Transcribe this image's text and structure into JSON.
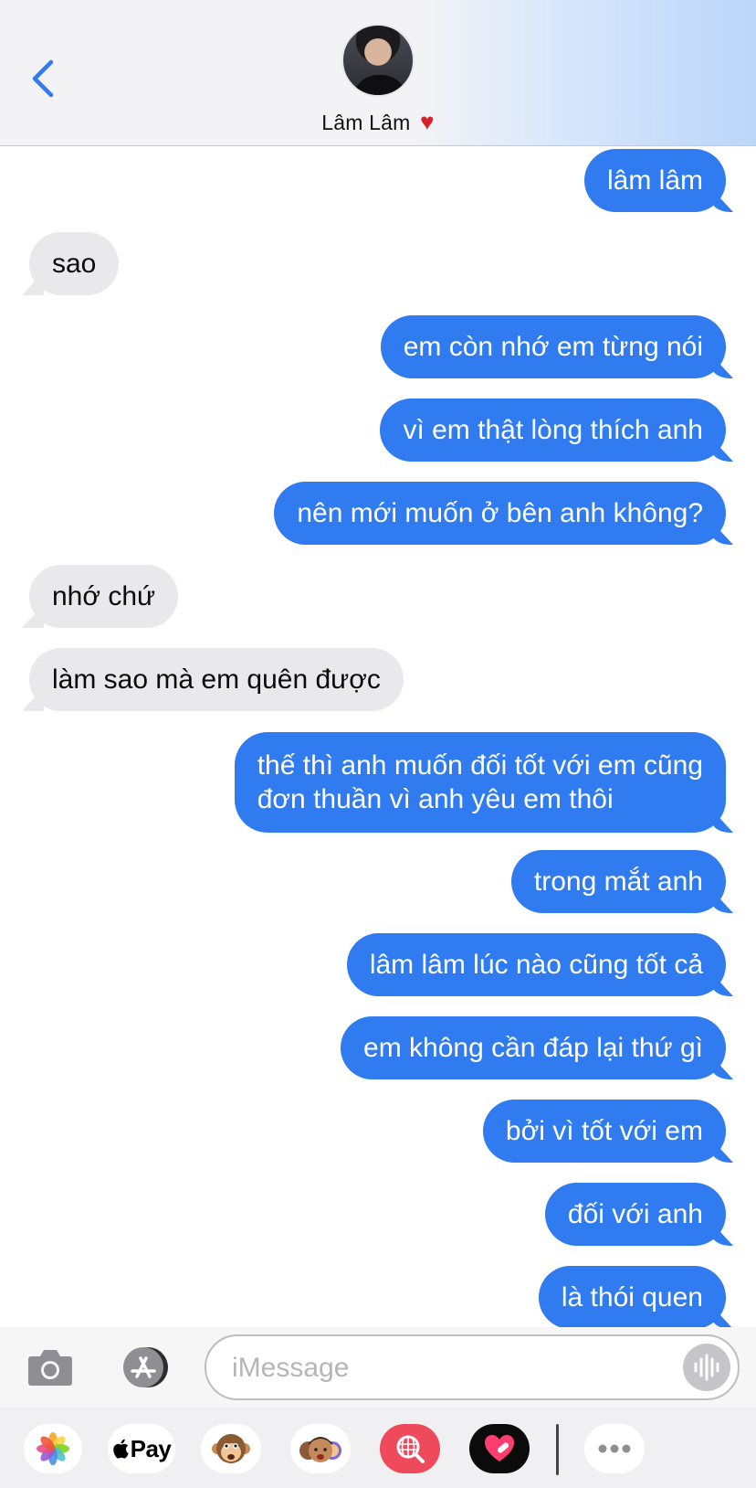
{
  "header": {
    "contact_name": "Lâm Lâm",
    "heart_emoji": "♥"
  },
  "messages": [
    {
      "from": "me",
      "text": "lâm lâm"
    },
    {
      "from": "them",
      "text": "sao"
    },
    {
      "from": "me",
      "text": "em còn nhớ em từng nói"
    },
    {
      "from": "me",
      "text": "vì em thật lòng thích anh"
    },
    {
      "from": "me",
      "text": "nên mới muốn ở bên anh không?"
    },
    {
      "from": "them",
      "text": "nhớ chứ"
    },
    {
      "from": "them",
      "text": "làm sao mà em quên được"
    },
    {
      "from": "me",
      "text_line1": "thế thì anh muốn đối tốt với em cũng",
      "text_line2": "đơn thuần vì anh yêu em thôi"
    },
    {
      "from": "me",
      "text": "trong mắt anh"
    },
    {
      "from": "me",
      "text": "lâm lâm lúc nào cũng tốt cả"
    },
    {
      "from": "me",
      "text": "em không cần đáp lại thứ gì"
    },
    {
      "from": "me",
      "text": "bởi vì tốt với em"
    },
    {
      "from": "me",
      "text": "đối với anh"
    },
    {
      "from": "me",
      "text": "là thói quen"
    }
  ],
  "input": {
    "placeholder": "iMessage",
    "value": ""
  },
  "apps": {
    "applepay_label": "Pay"
  },
  "colors": {
    "sent_bubble": "#2f7bef",
    "received_bubble": "#e9e9eb",
    "accent": "#2f7bef"
  }
}
